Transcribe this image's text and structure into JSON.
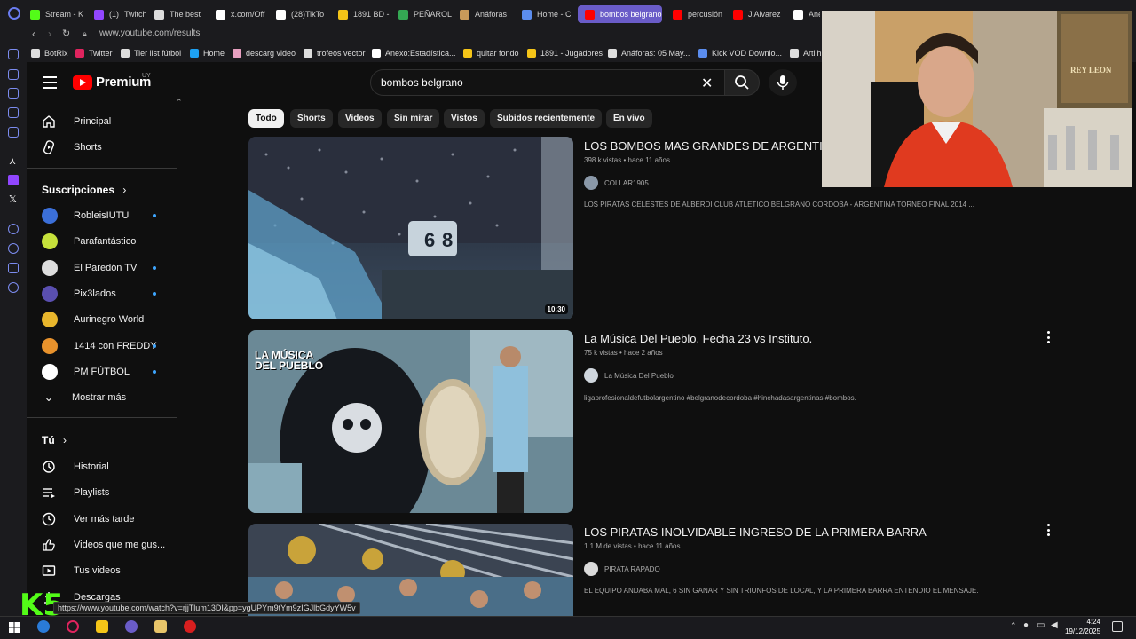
{
  "browser": {
    "tabs": [
      {
        "label": "Stream - K",
        "color": "#53fc18"
      },
      {
        "label": "Twitch",
        "prefix": "(1)",
        "color": "#9146ff"
      },
      {
        "label": "The best",
        "color": "#dddddd"
      },
      {
        "label": "x.com/Off",
        "color": "#ffffff"
      },
      {
        "label": "(28)TikTo",
        "color": "#ffffff"
      },
      {
        "label": "1891 BD -",
        "color": "#f5c518"
      },
      {
        "label": "PEÑAROL",
        "color": "#34a853"
      },
      {
        "label": "Anáforas",
        "color": "#c89a5a"
      },
      {
        "label": "Home - C",
        "color": "#5b8def"
      },
      {
        "label": "bombos belgrano",
        "color": "#ff0000"
      },
      {
        "label": "percusión",
        "color": "#ff0000"
      },
      {
        "label": "J Alvarez",
        "color": "#ff0000"
      },
      {
        "label": "Ane",
        "color": "#ffffff"
      }
    ],
    "url": "www.youtube.com/results",
    "bookmarks": [
      {
        "label": "BotRix",
        "color": "#dddddd"
      },
      {
        "label": "Twitter",
        "color": "#e0245e"
      },
      {
        "label": "Tier list fútbol",
        "color": "#dddddd"
      },
      {
        "label": "Home",
        "color": "#1da1f2"
      },
      {
        "label": "descarg video",
        "color": "#e8a0c0"
      },
      {
        "label": "trofeos vector",
        "color": "#dddddd"
      },
      {
        "label": "Anexo:Estadística...",
        "color": "#ffffff"
      },
      {
        "label": "quitar fondo",
        "color": "#f5c518"
      },
      {
        "label": "1891 - Jugadores",
        "color": "#f5c518"
      },
      {
        "label": "Anáforas: 05 May...",
        "color": "#dddddd"
      },
      {
        "label": "Kick VOD Downlo...",
        "color": "#5b8def"
      },
      {
        "label": "Artilh",
        "color": "#dddddd"
      }
    ]
  },
  "youtube": {
    "logo_text": "Premium",
    "country": "UY",
    "search_query": "bombos belgrano",
    "sidebar": {
      "main": [
        {
          "label": "Principal",
          "icon": "home-icon"
        },
        {
          "label": "Shorts",
          "icon": "shorts-icon"
        }
      ],
      "subscriptions_heading": "Suscripciones",
      "subscriptions": [
        {
          "label": "RobleisIUTU",
          "color": "#3b6fd8",
          "live": true
        },
        {
          "label": "Parafantástico",
          "color": "#c6e13b",
          "live": false
        },
        {
          "label": "El Paredón TV",
          "color": "#dddddd",
          "live": true
        },
        {
          "label": "Pix3lados",
          "color": "#5a4fb0",
          "live": true
        },
        {
          "label": "Aurinegro World",
          "color": "#e8b62c",
          "live": false
        },
        {
          "label": "1414 con FREDDY",
          "color": "#e8922c",
          "live": true
        },
        {
          "label": "PM FÚTBOL",
          "color": "#ffffff",
          "live": true
        }
      ],
      "show_more": "Mostrar más",
      "you_heading": "Tú",
      "you_items": [
        {
          "label": "Historial",
          "icon": "history-icon"
        },
        {
          "label": "Playlists",
          "icon": "playlists-icon"
        },
        {
          "label": "Ver más tarde",
          "icon": "watch-later-icon"
        },
        {
          "label": "Videos que me gus...",
          "icon": "like-icon"
        },
        {
          "label": "Tus videos",
          "icon": "your-videos-icon"
        },
        {
          "label": "Descargas",
          "icon": "download-icon"
        }
      ]
    },
    "chips": [
      "Todo",
      "Shorts",
      "Videos",
      "Sin mirar",
      "Vistos",
      "Subidos recientemente",
      "En vivo"
    ],
    "results": [
      {
        "title": "LOS BOMBOS MAS GRANDES DE ARGENTINA",
        "views": "398 k vistas",
        "age": "hace 11 años",
        "channel": "COLLAR1905",
        "description": "LOS PIRATAS CELESTES DE ALBERDI CLUB ATLETICO BELGRANO CORDOBA - ARGENTINA TORNEO FINAL 2014 ...",
        "duration": "10:30"
      },
      {
        "title": "La Música Del Pueblo. Fecha 23 vs Instituto.",
        "views": "75 k vistas",
        "age": "hace 2 años",
        "channel": "La Música Del Pueblo",
        "description": "ligaprofesionaldefutbolargentino #belgranodecordoba #hinchadasargentinas #bombos.",
        "thumb_text": "LA MÚSICA DEL PUEBLO"
      },
      {
        "title": "LOS PIRATAS INOLVIDABLE INGRESO DE LA PRIMERA BARRA",
        "views": "1.1 M de vistas",
        "age": "hace 11 años",
        "channel": "PIRATA RAPADO",
        "description": "EL EQUIPO ANDABA MAL, 6 SIN GANAR Y SIN TRIUNFOS DE LOCAL, Y LA PRIMERA BARRA ENTENDIO EL MENSAJE."
      }
    ],
    "status_url": "https://www.youtube.com/watch?v=rjjTlum13DI&pp=ygUPYm9tYm9zIGJlbGdyYW5v"
  },
  "webcam": {
    "poster_text": "REY LEON"
  },
  "overlay_logo": "K5",
  "clock": {
    "time": "4:24",
    "date": "19/12/2025"
  }
}
